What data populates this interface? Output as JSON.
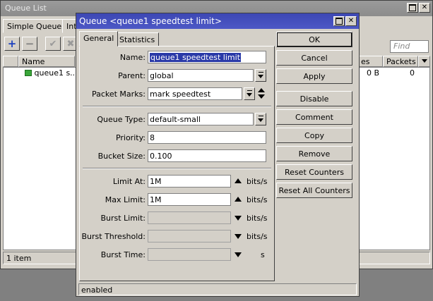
{
  "background_window": {
    "title": "Queue List",
    "tabs": [
      "Simple Queues",
      "Int"
    ],
    "find_placeholder": "Find",
    "columns": {
      "name": "Name",
      "bytes": "es",
      "packets": "Packets"
    },
    "row": {
      "name": "queue1 s...",
      "bytes": "0 B",
      "packets": "0"
    },
    "status": "1 item"
  },
  "dialog": {
    "title": "Queue <queue1 speedtest limit>",
    "tabs": {
      "general": "General",
      "statistics": "Statistics"
    },
    "fields": {
      "name": {
        "label": "Name:",
        "value": "queue1 speedtest limit"
      },
      "parent": {
        "label": "Parent:",
        "value": "global"
      },
      "packet_marks": {
        "label": "Packet Marks:",
        "value": "mark speedtest"
      },
      "queue_type": {
        "label": "Queue Type:",
        "value": "default-small"
      },
      "priority": {
        "label": "Priority:",
        "value": "8"
      },
      "bucket_size": {
        "label": "Bucket Size:",
        "value": "0.100"
      },
      "limit_at": {
        "label": "Limit At:",
        "value": "1M",
        "unit": "bits/s"
      },
      "max_limit": {
        "label": "Max Limit:",
        "value": "1M",
        "unit": "bits/s"
      },
      "burst_limit": {
        "label": "Burst Limit:",
        "value": "",
        "unit": "bits/s"
      },
      "burst_threshold": {
        "label": "Burst Threshold:",
        "value": "",
        "unit": "bits/s"
      },
      "burst_time": {
        "label": "Burst Time:",
        "value": "",
        "unit": "s"
      }
    },
    "buttons": {
      "ok": "OK",
      "cancel": "Cancel",
      "apply": "Apply",
      "disable": "Disable",
      "comment": "Comment",
      "copy": "Copy",
      "remove": "Remove",
      "reset_counters": "Reset Counters",
      "reset_all_counters": "Reset All Counters"
    },
    "status": "enabled"
  },
  "colors": {
    "title_active": "#3c47b4",
    "title_inactive": "#8c8c8c",
    "face": "#d4d0c8",
    "selection": "#2a3aa8",
    "add_icon": "#1a3fbf",
    "queue_icon": "#3aa63a"
  }
}
